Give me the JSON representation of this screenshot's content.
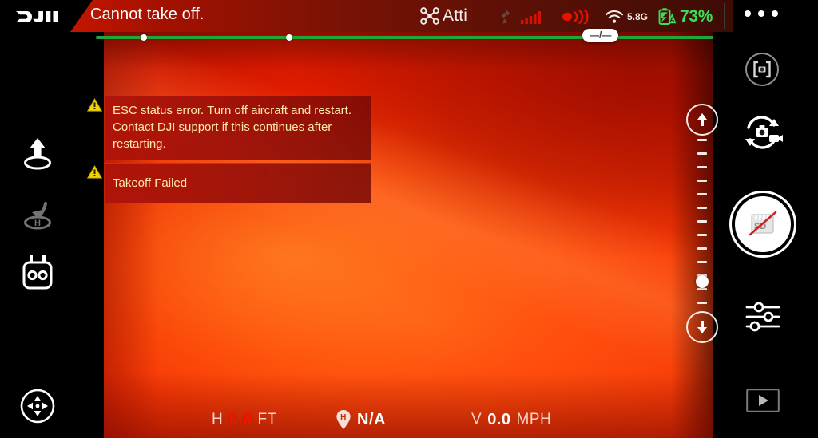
{
  "app": {
    "brand": "DJI",
    "warning_title": "Cannot take off."
  },
  "status_bar": {
    "flight_mode": "Atti",
    "flight_mode_icon": "drone-icon",
    "gps_icon": "satellite-icon",
    "gps_signal_bars": 5,
    "rc_icon": "rc-transmission-icon",
    "wifi_icon": "wifi-icon",
    "wifi_band": "5.8G",
    "battery_icon": "battery-icon",
    "battery_percent": "73%",
    "battery_color": "#3ddc5b",
    "menu_icon": "more-options-icon"
  },
  "progress": {
    "pill_label": "—/—",
    "bar_color": "#1fa83a",
    "markers": [
      60,
      242
    ]
  },
  "left_toolbar": {
    "items": [
      {
        "name": "takeoff-button",
        "icon": "takeoff-arrow-icon",
        "enabled": true
      },
      {
        "name": "return-to-home-button",
        "icon": "return-home-icon",
        "enabled": false
      },
      {
        "name": "remote-controller-button",
        "icon": "remote-controller-icon",
        "enabled": true
      },
      {
        "name": "virtual-joystick-button",
        "icon": "dpad-icon",
        "enabled": true
      }
    ]
  },
  "right_toolbar": {
    "items": [
      {
        "name": "focus-lock-button",
        "icon": "focus-frame-icon"
      },
      {
        "name": "camera-mode-toggle-button",
        "icon": "photo-video-switch-icon"
      },
      {
        "name": "shutter-button",
        "icon": "sd-card-disabled-icon"
      },
      {
        "name": "camera-settings-button",
        "icon": "sliders-icon"
      },
      {
        "name": "playback-button",
        "icon": "play-icon"
      }
    ]
  },
  "gimbal_slider": {
    "up_icon": "arrow-up-icon",
    "down_icon": "arrow-down-icon",
    "ticks": 13,
    "handle_position_percent": 80
  },
  "warnings": [
    {
      "icon": "warning-triangle-icon",
      "text": "ESC status error. Turn off aircraft and restart. Contact DJI support if this continues after restarting."
    },
    {
      "icon": "warning-triangle-icon",
      "text": "Takeoff Failed"
    }
  ],
  "telemetry": {
    "altitude": {
      "label": "H",
      "value": "0.0",
      "unit": "FT",
      "alert": true
    },
    "distance": {
      "icon": "home-pin-icon",
      "value": "N/A"
    },
    "velocity": {
      "label": "V",
      "value": "0.0",
      "unit": "MPH",
      "alert": false
    }
  }
}
